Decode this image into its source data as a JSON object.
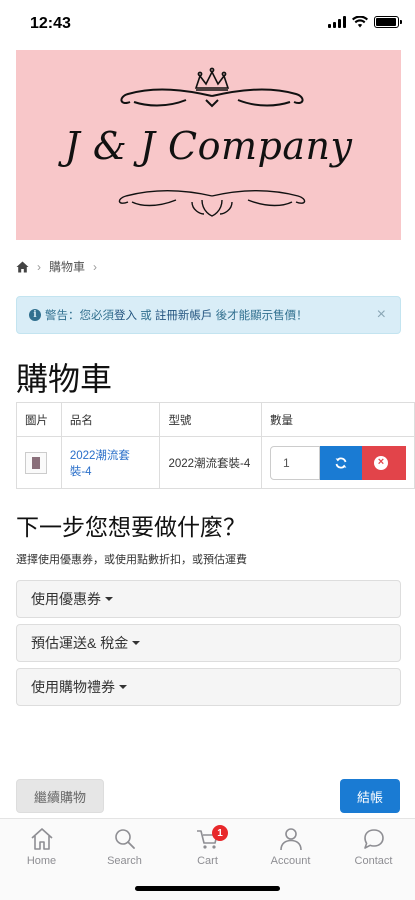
{
  "status_bar": {
    "time": "12:43",
    "battery_level": 0.95
  },
  "banner": {
    "title": "J & J Company"
  },
  "breadcrumb": {
    "home_icon": "home-icon",
    "items": [
      "購物車"
    ]
  },
  "alert": {
    "prefix": "警告：您必須",
    "login_link": "登入",
    "mid": " 或 ",
    "register_link": "註冊新帳戶",
    "suffix": " 後才能顯示售價！",
    "close": "×"
  },
  "cart": {
    "heading": "購物車",
    "columns": [
      "圖片",
      "品名",
      "型號",
      "數量"
    ],
    "rows": [
      {
        "name": "2022潮流套裝-4",
        "model": "2022潮流套裝-4",
        "quantity": "1"
      }
    ]
  },
  "next_steps": {
    "heading": "下一步您想要做什麼？",
    "subtitle": "選擇使用優惠券，或使用點數折扣，或預估運費",
    "panels": [
      "使用優惠券",
      "預估運送& 稅金",
      "使用購物禮券"
    ]
  },
  "actions": {
    "continue": "繼續購物",
    "checkout": "結帳"
  },
  "tab_bar": {
    "tabs": [
      {
        "label": "Home",
        "icon": "home-icon"
      },
      {
        "label": "Search",
        "icon": "search-icon"
      },
      {
        "label": "Cart",
        "icon": "cart-icon",
        "badge": "1"
      },
      {
        "label": "Account",
        "icon": "person-icon"
      },
      {
        "label": "Contact",
        "icon": "chat-icon"
      }
    ]
  },
  "colors": {
    "banner_bg": "#f8c7c9",
    "primary": "#1a7bd3",
    "danger": "#e2444a",
    "alert_bg": "#d9edf7",
    "badge": "#e8282b"
  }
}
